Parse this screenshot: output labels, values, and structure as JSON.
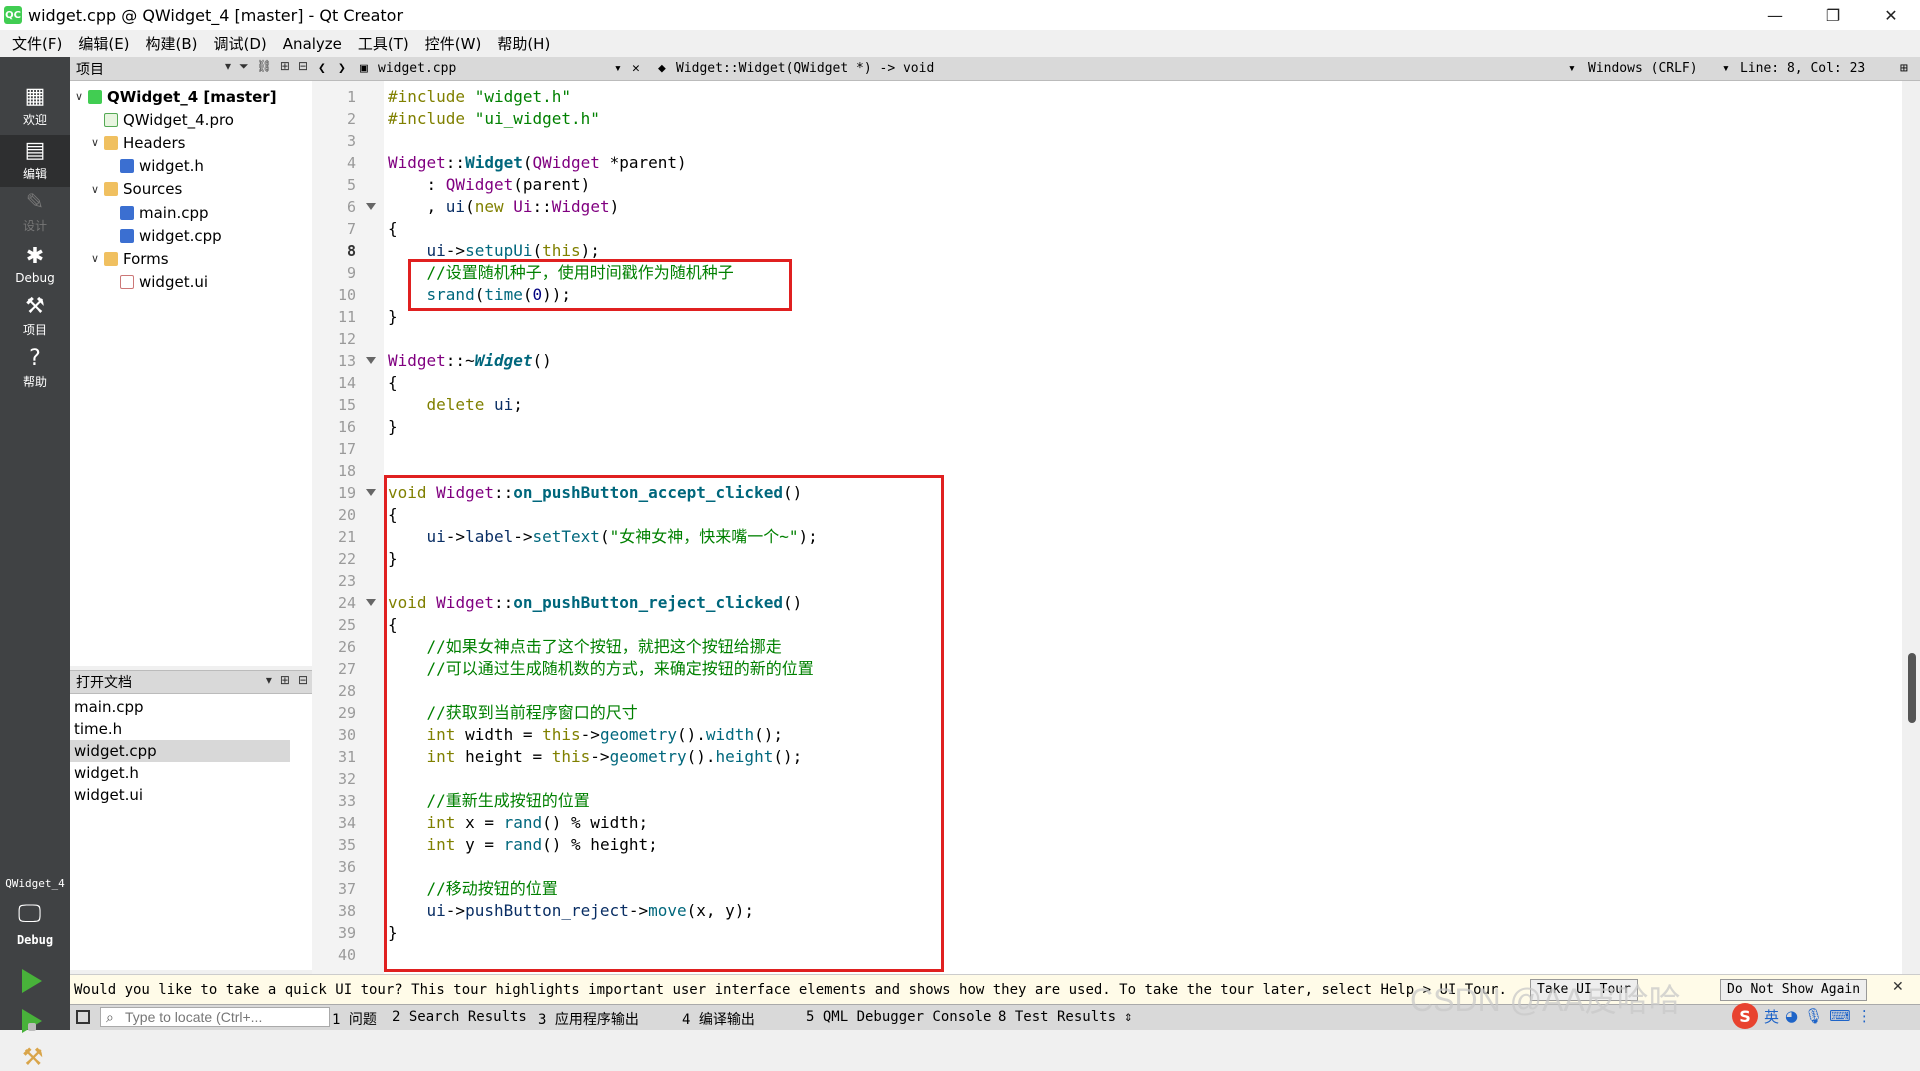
{
  "window": {
    "title": "widget.cpp @ QWidget_4 [master] - Qt Creator",
    "app_icon": "QC",
    "minimize": "—",
    "maximize": "❐",
    "close": "✕"
  },
  "menu": [
    "文件(F)",
    "编辑(E)",
    "构建(B)",
    "调试(D)",
    "Analyze",
    "工具(T)",
    "控件(W)",
    "帮助(H)"
  ],
  "modes": [
    {
      "label": "欢迎",
      "icon": "grid-icon"
    },
    {
      "label": "编辑",
      "icon": "edit-icon"
    },
    {
      "label": "设计",
      "icon": "pen-icon"
    },
    {
      "label": "Debug",
      "icon": "bug-icon"
    },
    {
      "label": "项目",
      "icon": "wrench-icon"
    },
    {
      "label": "帮助",
      "icon": "help-icon"
    }
  ],
  "kit": {
    "project": "QWidget_4",
    "build": "Debug"
  },
  "project_panel": {
    "title": "项目",
    "tree": [
      {
        "label": "QWidget_4 [master]",
        "level": 0,
        "arrow": "∨",
        "bold": true,
        "icon": "proj"
      },
      {
        "label": "QWidget_4.pro",
        "level": 1,
        "arrow": "",
        "icon": "pro"
      },
      {
        "label": "Headers",
        "level": 1,
        "arrow": "∨",
        "icon": "folder-h"
      },
      {
        "label": "widget.h",
        "level": 2,
        "arrow": "",
        "icon": "h"
      },
      {
        "label": "Sources",
        "level": 1,
        "arrow": "∨",
        "icon": "folder-s"
      },
      {
        "label": "main.cpp",
        "level": 2,
        "arrow": "",
        "icon": "cpp"
      },
      {
        "label": "widget.cpp",
        "level": 2,
        "arrow": "",
        "icon": "cpp"
      },
      {
        "label": "Forms",
        "level": 1,
        "arrow": "∨",
        "icon": "folder-f"
      },
      {
        "label": "widget.ui",
        "level": 2,
        "arrow": "",
        "icon": "ui"
      }
    ]
  },
  "open_documents": {
    "title": "打开文档",
    "items": [
      "main.cpp",
      "time.h",
      "widget.cpp",
      "widget.h",
      "widget.ui"
    ],
    "selected": "widget.cpp"
  },
  "editor_toolbar": {
    "file": "widget.cpp",
    "symbol": "Widget::Widget(QWidget *) -> void",
    "line_ending": "Windows (CRLF)",
    "position": "Line: 8, Col: 23"
  },
  "editor": {
    "current_line": 8,
    "line_count": 40,
    "fold_lines": [
      6,
      13,
      19,
      24
    ]
  },
  "tour": {
    "message": "Would you like to take a quick UI tour? This tour highlights important user interface elements and shows how they are used. To take the tour later, select Help > UI Tour.",
    "take_button": "Take UI Tour",
    "dismiss_button": "Do Not Show Again"
  },
  "statusbar": {
    "locator_placeholder": "Type to locate (Ctrl+...",
    "panes": [
      "1 问题",
      "2 Search Results",
      "3 应用程序输出",
      "4 编译输出",
      "5 QML Debugger Console",
      "8 Test Results"
    ]
  },
  "watermark": "CSDN @AA皮哈哈",
  "ime": {
    "lang": "英"
  },
  "colors": {
    "highlight_box": "#e02020",
    "mode_bar": "#404244",
    "keyword": "#808000",
    "string": "#008000"
  }
}
